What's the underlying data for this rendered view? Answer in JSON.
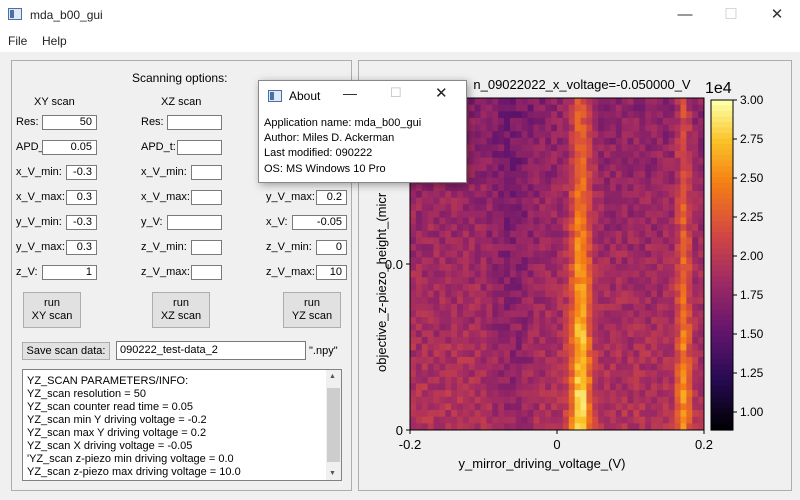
{
  "window": {
    "title": "mda_b00_gui",
    "minimize": "—",
    "maximize": "☐",
    "close": "✕"
  },
  "menu": [
    "File",
    "Help"
  ],
  "options": {
    "title": "Scanning options:",
    "xy": {
      "header": "XY scan",
      "res_label": "Res:",
      "res": "50",
      "apd_label": "APD_t:",
      "apd": "0.05",
      "xmin_label": "x_V_min:",
      "xmin": "-0.3",
      "xmax_label": "x_V_max:",
      "xmax": "0.3",
      "ymin_label": "y_V_min:",
      "ymin": "-0.3",
      "ymax_label": "y_V_max:",
      "ymax": "0.3",
      "zv_label": "z_V:",
      "zv": "1",
      "run": [
        "run",
        "XY scan"
      ]
    },
    "xz": {
      "header": "XZ scan",
      "res_label": "Res:",
      "apd_label": "APD_t:",
      "xmin_label": "x_V_min:",
      "xmax_label": "x_V_max:",
      "yv_label": "y_V:",
      "zmin_label": "z_V_min:",
      "zmax_label": "z_V_max:",
      "run": [
        "run",
        "XZ scan"
      ]
    },
    "yz": {
      "ymax_label": "y_V_max:",
      "ymax": "0.2",
      "xv_label": "x_V:",
      "xv": "-0.05",
      "zmin_label": "z_V_min:",
      "zmin": "0",
      "zmax_label": "z_V_max:",
      "zmax": "10",
      "run": [
        "run",
        "YZ scan"
      ]
    }
  },
  "save": {
    "button": "Save scan data:",
    "filename": "090222_test-data_2",
    "ext": "\".npy\""
  },
  "info_lines": [
    "YZ_SCAN PARAMETERS/INFO:",
    "YZ_scan resolution = 50",
    "YZ_scan counter read time = 0.05",
    "YZ_scan min Y driving voltage = -0.2",
    "YZ_scan max Y driving voltage = 0.2",
    "YZ_scan X driving voltage = -0.05",
    "'YZ_scan z-piezo min driving voltage = 0.0",
    "YZ_scan z-piezo max driving voltage = 10.0"
  ],
  "plot": {
    "title": "n_09022022_x_voltage=-0.050000_V",
    "xlabel": "y_mirror_driving_voltage_(V)",
    "ylabel": "objective_z-piezo_height_(micr",
    "xticks": [
      "-0.2",
      "0",
      "0.2"
    ],
    "yticks": [
      "0.0",
      "0"
    ],
    "cbar_exp": "1e4",
    "cbar_ticks": [
      "3.00",
      "2.75",
      "2.50",
      "2.25",
      "2.00",
      "1.75",
      "1.50",
      "1.25",
      "1.00"
    ],
    "colormap": "inferno"
  },
  "about": {
    "title": "About",
    "lines": [
      "Application name: mda_b00_gui",
      "Author: Miles D. Ackerman",
      "Last modified: 090222",
      "OS: MS Windows 10 Pro"
    ]
  }
}
